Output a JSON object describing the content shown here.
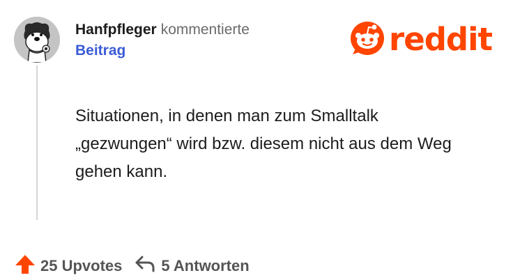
{
  "comment": {
    "username": "Hanfpfleger",
    "action": "kommentierte",
    "post_link": "Beitrag",
    "text": "Situationen, in denen man zum Smalltalk „gezwungen“ wird bzw. diesem nicht aus dem Weg gehen kann."
  },
  "logo": {
    "text": "reddit"
  },
  "actions": {
    "upvotes": "25 Upvotes",
    "replies": "5 Antworten"
  },
  "icons": {
    "upvote": "upvote-arrow-icon",
    "reply": "reply-arrow-icon",
    "logo": "reddit-snoo-icon"
  },
  "colors": {
    "brand": "#ff4500",
    "link": "#3b5bd6",
    "muted": "#6b6b6b"
  }
}
